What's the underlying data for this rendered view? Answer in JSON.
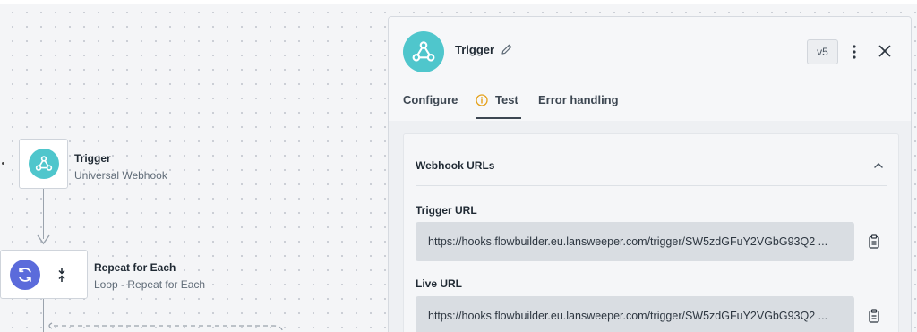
{
  "canvas": {
    "trigger_node": {
      "title": "Trigger",
      "subtitle": "Universal Webhook",
      "icon": "webhook-icon"
    },
    "loop_node": {
      "title": "Repeat for Each",
      "subtitle": "Loop - Repeat for Each",
      "icon": "refresh-icon",
      "side_icon": "merge-arrows-icon"
    }
  },
  "panel": {
    "title": "Trigger",
    "version": "v5",
    "tabs": [
      {
        "label": "Configure",
        "active": false
      },
      {
        "label": "Test",
        "active": true,
        "icon": "info-icon"
      },
      {
        "label": "Error handling",
        "active": false
      }
    ],
    "section": {
      "title": "Webhook URLs",
      "trigger_url_label": "Trigger URL",
      "trigger_url": "https://hooks.flowbuilder.eu.lansweeper.com/trigger/SW5zdGFuY2VGbG93Q2 ...",
      "live_url_label": "Live URL",
      "live_url": "https://hooks.flowbuilder.eu.lansweeper.com/trigger/SW5zdGFuY2VGbG93Q2 ..."
    }
  },
  "colors": {
    "teal": "#4fc6cc",
    "blue": "#5b6bdb",
    "info_yellow": "#e5a11a"
  }
}
